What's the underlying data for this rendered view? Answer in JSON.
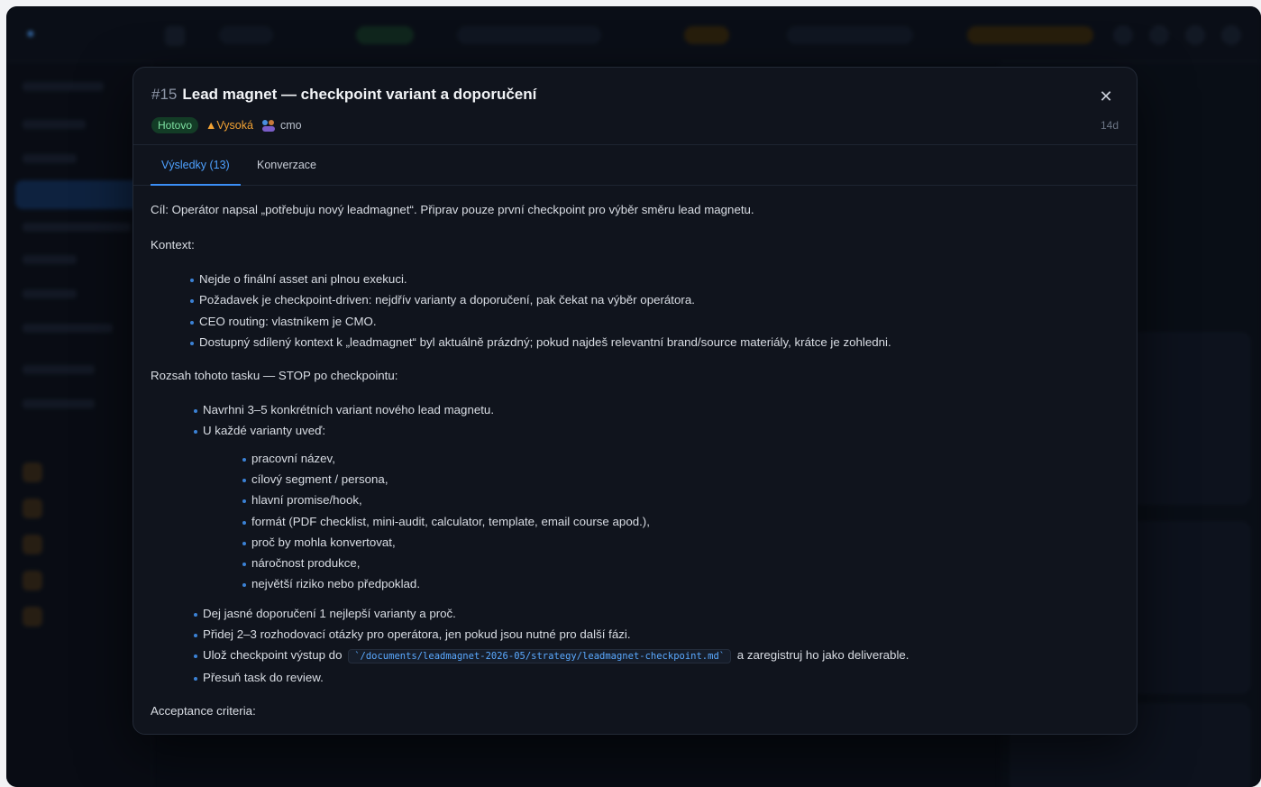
{
  "task": {
    "number": "#15",
    "title": "Lead magnet — checkpoint variant a doporučení",
    "status": "Hotovo",
    "priority": "▲Vysoká",
    "assignee": "cmo",
    "age": "14d"
  },
  "tabs": [
    {
      "label": "Výsledky (13)",
      "active": true
    },
    {
      "label": "Konverzace",
      "active": false
    }
  ],
  "body": {
    "goal": "Cíl: Operátor napsal „potřebuju nový leadmagnet“. Připrav pouze první checkpoint pro výběr směru lead magnetu.",
    "context_heading": "Kontext:",
    "context_items": [
      "Nejde o finální asset ani plnou exekuci.",
      "Požadavek je checkpoint-driven: nejdřív varianty a doporučení, pak čekat na výběr operátora.",
      "CEO routing: vlastníkem je CMO.",
      "Dostupný sdílený kontext k „leadmagnet“ byl aktuálně prázdný; pokud najdeš relevantní brand/source materiály, krátce je zohledni."
    ],
    "scope_heading": "Rozsah tohoto tasku — STOP po checkpointu:",
    "scope_items": [
      "Navrhni 3–5 konkrétních variant nového lead magnetu.",
      "U každé varianty uveď:"
    ],
    "variant_fields": [
      "pracovní název,",
      "cílový segment / persona,",
      "hlavní promise/hook,",
      "formát (PDF checklist, mini-audit, calculator, template, email course apod.),",
      "proč by mohla konvertovat,",
      "náročnost produkce,",
      "největší riziko nebo předpoklad."
    ],
    "scope_items_2": [
      "Dej jasné doporučení 1 nejlepší varianty a proč.",
      "Přidej 2–3 rozhodovací otázky pro operátora, jen pokud jsou nutné pro další fázi."
    ],
    "save_prefix": "Ulož checkpoint výstup do",
    "save_path": "`/documents/leadmagnet-2026-05/strategy/leadmagnet-checkpoint.md`",
    "save_suffix": "a zaregistruj ho jako deliverable.",
    "move_item": "Přesuň task do review.",
    "acceptance_heading": "Acceptance criteria:"
  },
  "icons": {
    "close": "close-icon",
    "avatar": "cmo-avatar-icon"
  },
  "colors": {
    "accent": "#3b8ef5",
    "status_done": "#7ee2a2",
    "priority_high": "#f1a234"
  }
}
